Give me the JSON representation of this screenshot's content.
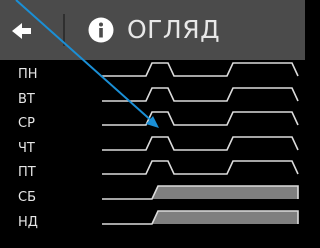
{
  "header": {
    "title": "ОГЛЯД",
    "back_icon": "arrow-left-icon",
    "info_icon": "info-icon"
  },
  "colors": {
    "header_bg": "#4b4b4b",
    "background": "#000000",
    "text": "#e8e8e8",
    "line": "#dcdcdc",
    "weekend_fill": "#7f7f7f",
    "pointer": "#1a8fd6"
  },
  "schedule": {
    "days": [
      {
        "label": "ПН",
        "weekend": false
      },
      {
        "label": "ВТ",
        "weekend": false
      },
      {
        "label": "СР",
        "weekend": false
      },
      {
        "label": "ЧТ",
        "weekend": false
      },
      {
        "label": "ПТ",
        "weekend": false
      },
      {
        "label": "СБ",
        "weekend": true
      },
      {
        "label": "НД",
        "weekend": true
      }
    ]
  }
}
